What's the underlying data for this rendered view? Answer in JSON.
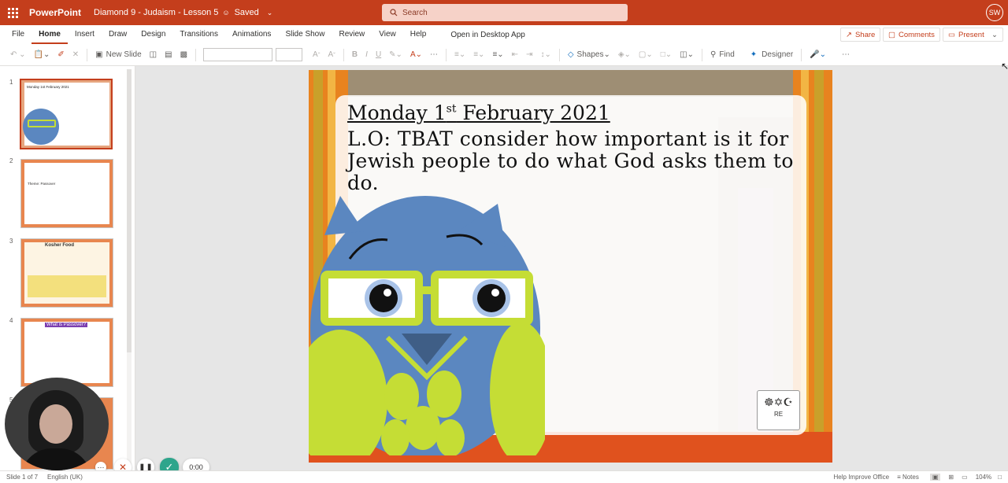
{
  "titlebar": {
    "app_name": "PowerPoint",
    "doc_title": "Diamond 9 - Judaism - Lesson 5",
    "save_status": "Saved",
    "search_placeholder": "Search",
    "avatar_initials": "SW"
  },
  "menu": {
    "items": [
      "File",
      "Home",
      "Insert",
      "Draw",
      "Design",
      "Transitions",
      "Animations",
      "Slide Show",
      "Review",
      "View",
      "Help"
    ],
    "active": "Home",
    "open_desktop": "Open in Desktop App"
  },
  "right_buttons": {
    "share": "Share",
    "comments": "Comments",
    "present": "Present"
  },
  "toolbar": {
    "new_slide": "New Slide",
    "shapes": "Shapes",
    "find": "Find",
    "designer": "Designer"
  },
  "thumbnails": [
    {
      "num": "1",
      "title": "Monday 1st February 2021"
    },
    {
      "num": "2",
      "title": "Theme: Passover"
    },
    {
      "num": "3",
      "title": "Kosher Food"
    },
    {
      "num": "4",
      "title": "What is Passover?"
    },
    {
      "num": "5",
      "title": ""
    }
  ],
  "slide": {
    "date_main": "Monday 1",
    "date_sup": "st",
    "date_rest": " February 2021",
    "objective": "L.O: TBAT consider how important is it for Jewish people to do what God asks them to do.",
    "badge_label": "RE"
  },
  "recorder": {
    "timer": "0:00"
  },
  "status": {
    "slide_info": "Slide 1 of 7",
    "language": "English (UK)",
    "help": "Help Improve Office",
    "notes": "Notes",
    "zoom": "104%"
  },
  "colors": {
    "accent": "#c43e1c",
    "owl_blue": "#5b87c0",
    "owl_green": "#c5dd35"
  }
}
